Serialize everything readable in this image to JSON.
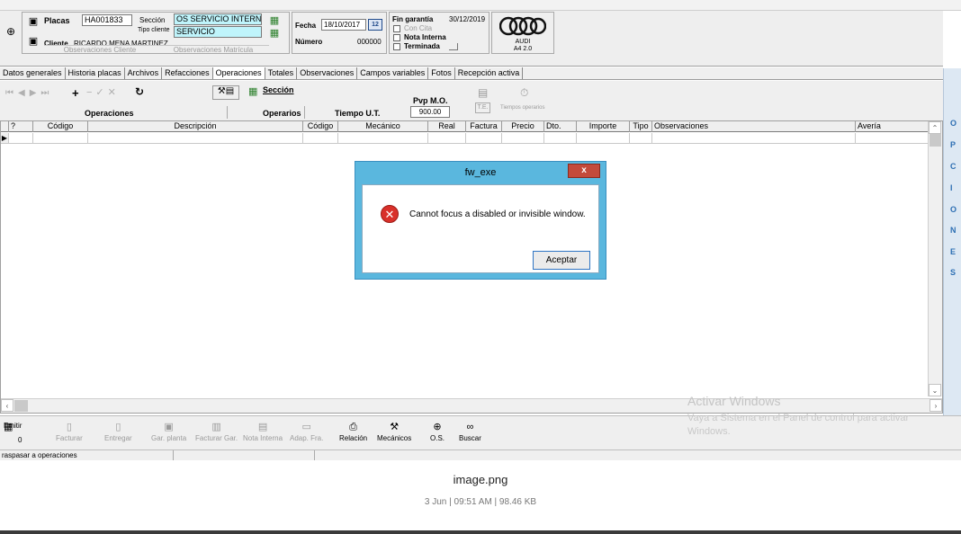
{
  "header": {
    "placas_label": "Placas",
    "placas_value": "HA001833",
    "cliente_label": "Cliente",
    "cliente_value": "RICARDO MENA MARTINEZ",
    "obs_cliente": "Observaciones Cliente",
    "seccion_label": "Sección",
    "seccion_value": "OS SERVICIO INTERNA",
    "tipo_cliente_label": "Tipo cliente",
    "tipo_cliente_value": "SERVICIO",
    "obs_matricula": "Observaciones Matrícula",
    "fecha_label": "Fecha",
    "fecha_value": "18/10/2017",
    "numero_label": "Número",
    "numero_value": "000000",
    "fin_garantia_label": "Fin garantía",
    "fin_garantia_value": "30/12/2019",
    "con_cita": "Con Cita",
    "nota_interna": "Nota Interna",
    "terminada": "Terminada",
    "brand": "AUDI",
    "model": "A4 2.0"
  },
  "tabs": [
    "Datos generales",
    "Historia placas",
    "Archivos",
    "Refacciones",
    "Operaciones",
    "Totales",
    "Observaciones",
    "Campos variables",
    "Fotos",
    "Recepción activa"
  ],
  "toolbar": {
    "operaciones": "Operaciones",
    "seccion_link": "Sección",
    "operarios": "Operarios",
    "tiempo_ut": "Tiempo U.T.",
    "pvp_mo_label": "Pvp M.O.",
    "pvp_mo_value": "900.00",
    "te": "T.E.",
    "tiempos_operarios": "Tiempos operarios"
  },
  "grid": {
    "columns": [
      "?",
      "Código",
      "Descripción",
      "Código",
      "Mecánico",
      "Real",
      "Factura",
      "Precio",
      "Dto.",
      "Importe",
      "Tipo",
      "Observaciones",
      "Avería"
    ]
  },
  "side_letters": [
    "O",
    "P",
    "C",
    "I",
    "O",
    "N",
    "E",
    "S"
  ],
  "bottom": {
    "emitir": "Emitir",
    "count": "0",
    "buttons": [
      "Facturar",
      "Entregar",
      "Gar. planta",
      "Facturar Gar.",
      "Nota Interna",
      "Adap. Fra.",
      "Relación",
      "Mecánicos",
      "O.S.",
      "Buscar"
    ]
  },
  "status": "raspasar a operaciones",
  "dialog": {
    "title": "fw_exe",
    "message": "Cannot focus a disabled or invisible window.",
    "button": "Aceptar",
    "close": "x"
  },
  "watermark": {
    "title": "Activar Windows",
    "text": "Vaya a Sistema en el Panel de control para activar Windows."
  },
  "viewer": {
    "filename": "image.png",
    "meta": "3 Jun | 09:51 AM | 98.46 KB"
  }
}
